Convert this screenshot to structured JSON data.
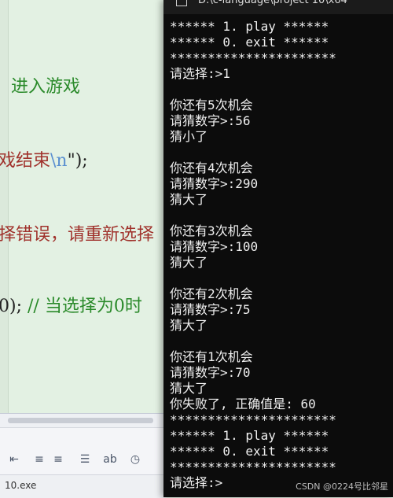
{
  "editor": {
    "line1": "进入游戏",
    "line2_text": "戏结束",
    "line2_escape": "\\n",
    "line2_tail": "\");",
    "line3": "择错误，请重新选择",
    "line4_code": "0);",
    "line4_comment": "// 当选择为0时"
  },
  "editor_toolbar": {
    "icons": [
      "indent-decrease-icon",
      "indent-increase-icon",
      "comment-icon",
      "replace-icon",
      "clock-icon"
    ]
  },
  "output_strip": {
    "label": "10.exe"
  },
  "console": {
    "title": "D:\\c-language\\project 10\\x64",
    "lines": [
      "****** 1. play ******",
      "****** 0. exit ******",
      "**********************",
      "请选择:>1",
      "",
      "你还有5次机会",
      "请猜数字>:56",
      "猜小了",
      "",
      "你还有4次机会",
      "请猜数字>:290",
      "猜大了",
      "",
      "你还有3次机会",
      "请猜数字>:100",
      "猜大了",
      "",
      "你还有2次机会",
      "请猜数字>:75",
      "猜大了",
      "",
      "你还有1次机会",
      "请猜数字>:70",
      "猜大了",
      "你失败了, 正确值是: 60",
      "**********************",
      "****** 1. play ******",
      "****** 0. exit ******",
      "**********************",
      "请选择:>"
    ]
  },
  "watermark": "CSDN @0224号比邻星"
}
